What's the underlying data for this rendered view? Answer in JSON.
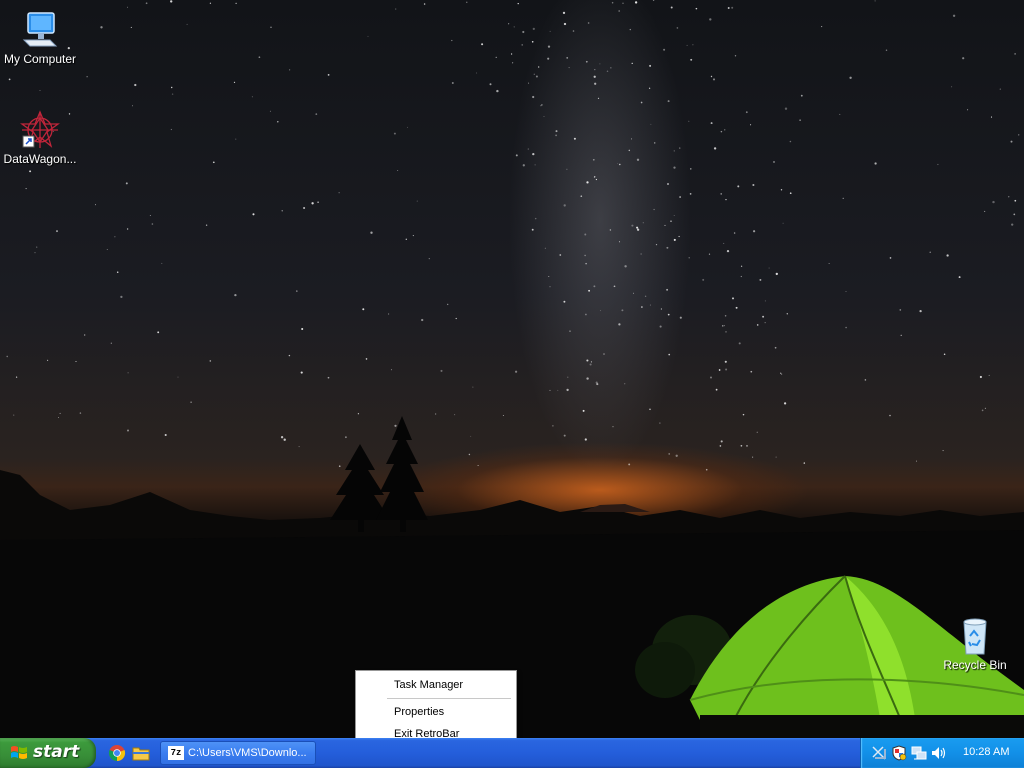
{
  "desktop": {
    "icons": [
      {
        "label": "My Computer",
        "icon": "computer-icon"
      },
      {
        "label": "DataWagon...",
        "icon": "datawagon-icon"
      },
      {
        "label": "Recycle Bin",
        "icon": "recycle-bin-icon"
      }
    ]
  },
  "context_menu": {
    "items": [
      {
        "label": "Task Manager"
      },
      {
        "label": "Properties"
      },
      {
        "label": "Exit RetroBar"
      }
    ]
  },
  "taskbar": {
    "start_label": "start",
    "quick_launch": [
      {
        "icon": "chrome-icon"
      },
      {
        "icon": "file-explorer-icon"
      }
    ],
    "task_button": {
      "label": "C:\\Users\\VMS\\Downlo...",
      "icon_text": "7z"
    },
    "tray": {
      "icons": [
        "network-disconnected-icon",
        "security-shield-icon",
        "network-icon",
        "volume-icon"
      ],
      "clock": "10:28 AM"
    }
  },
  "colors": {
    "taskbar_blue": "#245edb",
    "start_green": "#388e38",
    "tray_blue": "#1290e8",
    "horizon_orange": "#e66e1e",
    "tent_green": "#7ed321"
  }
}
